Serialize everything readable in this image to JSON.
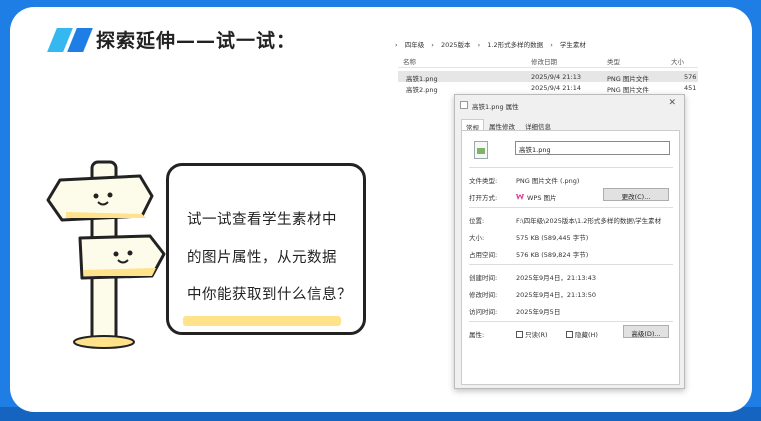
{
  "slide": {
    "title": "探索延伸——试一试：",
    "bubble_lines": [
      "试一试查看学生素材中",
      "的图片属性，从元数据",
      "中你能获取到什么信息？"
    ],
    "accent_colors": {
      "frame": "#1f7de6",
      "bar_light": "#35b8f0",
      "highlight": "#ffe28a",
      "sign_fill": "#fdfbe9"
    }
  },
  "explorer": {
    "breadcrumb": [
      "四年级",
      "2025版本",
      "1.2形式多样的数据",
      "学生素材"
    ],
    "columns": {
      "name": "名称",
      "date": "修改日期",
      "type": "类型",
      "size": "大小"
    },
    "files": [
      {
        "name": "高铁1.png",
        "date": "2025/9/4 21:13",
        "type": "PNG 图片文件",
        "size": "576"
      },
      {
        "name": "高铁2.png",
        "date": "2025/9/4 21:14",
        "type": "PNG 图片文件",
        "size": "451"
      }
    ]
  },
  "properties": {
    "title": "高铁1.png 属性",
    "tabs": [
      "常规",
      "属性修改",
      "详细信息"
    ],
    "filename": "高铁1.png",
    "file_type_label": "文件类型:",
    "file_type": "PNG 图片文件 (.png)",
    "open_with_label": "打开方式:",
    "open_with": "WPS 图片",
    "change_button": "更改(C)...",
    "location_label": "位置:",
    "location": "F:\\四年级\\2025版本\\1.2形式多样的数据\\学生素材",
    "size_label": "大小:",
    "size": "575 KB (589,445 字节)",
    "disk_size_label": "占用空间:",
    "disk_size": "576 KB (589,824 字节)",
    "created_label": "创建时间:",
    "created": "2025年9月4日，21:13:43",
    "modified_label": "修改时间:",
    "modified": "2025年9月4日，21:13:50",
    "accessed_label": "访问时间:",
    "accessed": "2025年9月5日",
    "attributes_label": "属性:",
    "readonly_label": "只读(R)",
    "hidden_label": "隐藏(H)",
    "advanced_button": "高级(D)..."
  }
}
